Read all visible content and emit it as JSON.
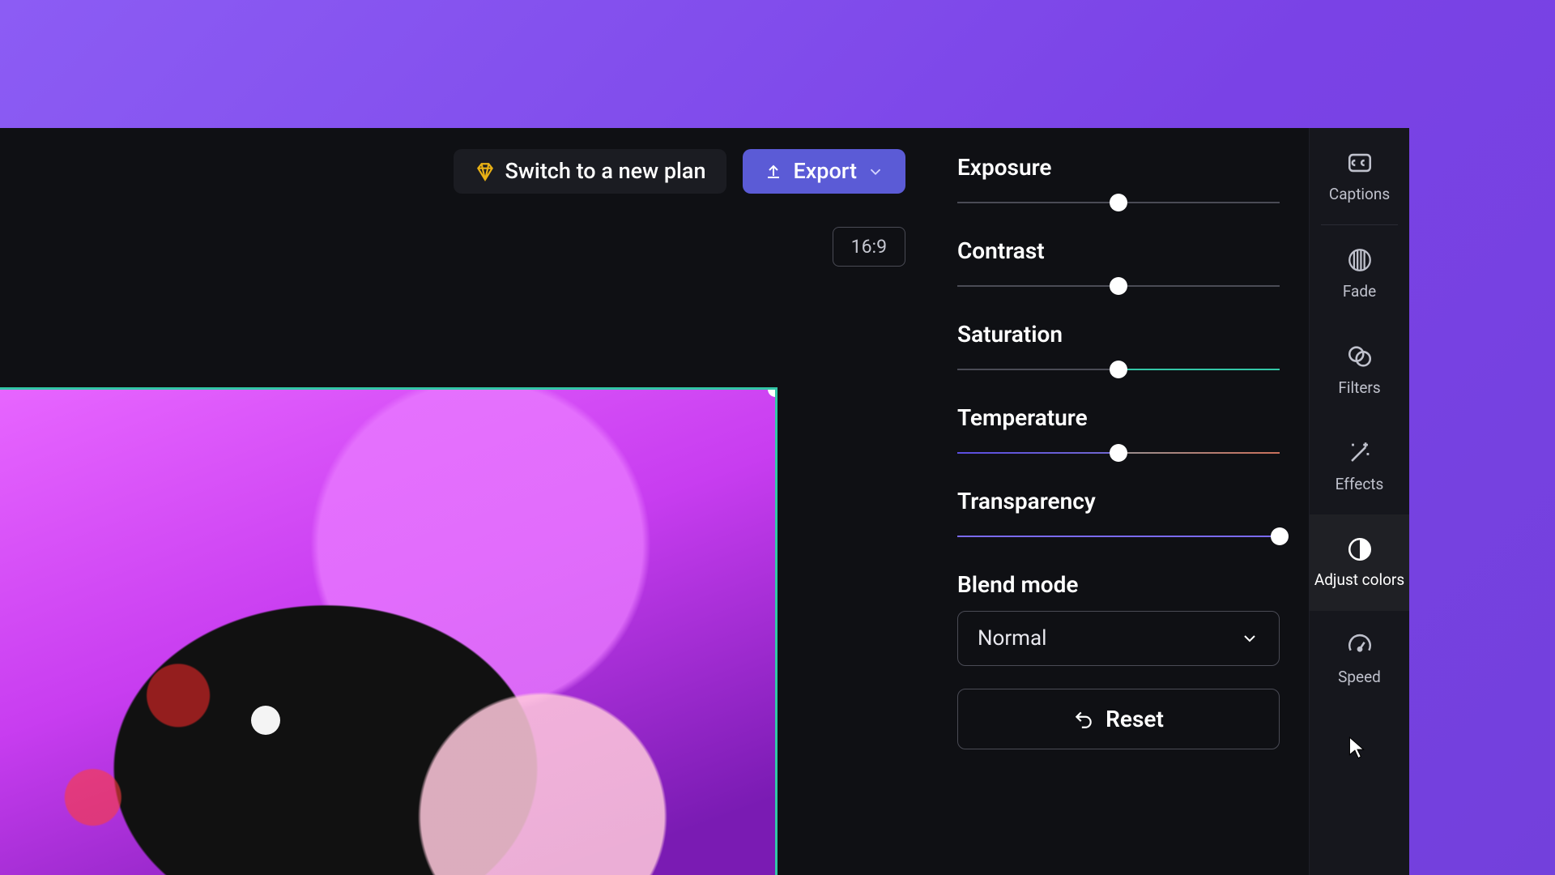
{
  "topbar": {
    "switch_plan_label": "Switch to a new plan",
    "export_label": "Export"
  },
  "canvas": {
    "aspect_ratio": "16:9"
  },
  "panel": {
    "sliders": [
      {
        "label": "Exposure",
        "value": 50,
        "track": "gray"
      },
      {
        "label": "Contrast",
        "value": 50,
        "track": "gray"
      },
      {
        "label": "Saturation",
        "value": 50,
        "track": "teal-right"
      },
      {
        "label": "Temperature",
        "value": 50,
        "track": "temp"
      },
      {
        "label": "Transparency",
        "value": 100,
        "track": "purple-full"
      }
    ],
    "blend_mode_label": "Blend mode",
    "blend_mode_value": "Normal",
    "reset_label": "Reset"
  },
  "rail": {
    "items": [
      {
        "id": "captions",
        "label": "Captions"
      },
      {
        "id": "fade",
        "label": "Fade"
      },
      {
        "id": "filters",
        "label": "Filters"
      },
      {
        "id": "effects",
        "label": "Effects"
      },
      {
        "id": "adjust-colors",
        "label": "Adjust colors"
      },
      {
        "id": "speed",
        "label": "Speed"
      }
    ],
    "active": "adjust-colors"
  },
  "colors": {
    "accent": "#5b5bd6",
    "teal": "#33c6a7",
    "bg": "#0f1014"
  }
}
